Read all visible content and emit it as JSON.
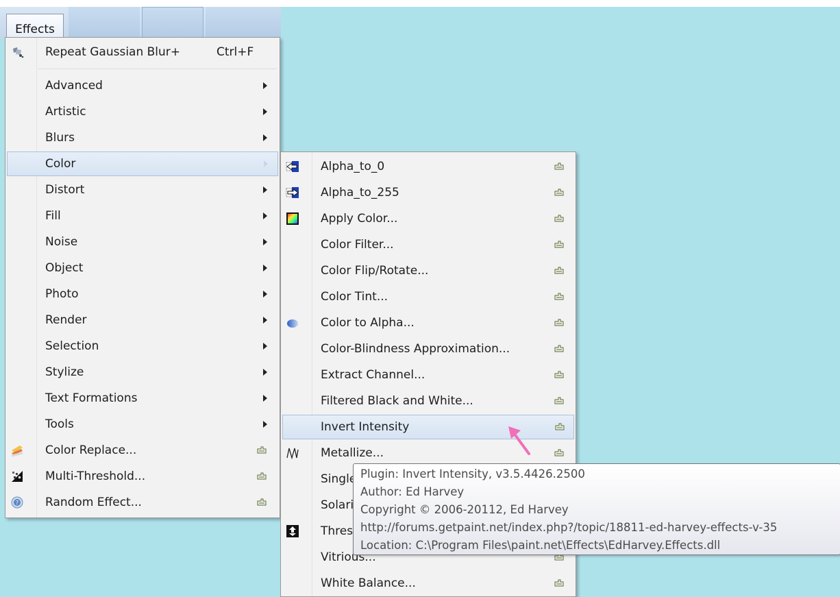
{
  "menubar": {
    "effects_label": "Effects"
  },
  "effects_menu": {
    "top_item": {
      "label": "Repeat Gaussian Blur+",
      "shortcut": "Ctrl+F",
      "icon": "gaussian-blur-icon"
    },
    "submenus": [
      {
        "label": "Advanced"
      },
      {
        "label": "Artistic"
      },
      {
        "label": "Blurs"
      },
      {
        "label": "Color"
      },
      {
        "label": "Distort"
      },
      {
        "label": "Fill"
      },
      {
        "label": "Noise"
      },
      {
        "label": "Object"
      },
      {
        "label": "Photo"
      },
      {
        "label": "Render"
      },
      {
        "label": "Selection"
      },
      {
        "label": "Stylize"
      },
      {
        "label": "Text Formations"
      },
      {
        "label": "Tools"
      }
    ],
    "effects": [
      {
        "label": "Color Replace...",
        "icon": "color-replace-icon"
      },
      {
        "label": "Multi-Threshold...",
        "icon": "multi-threshold-icon"
      },
      {
        "label": "Random Effect...",
        "icon": "random-effect-icon"
      }
    ],
    "highlighted": "Color"
  },
  "color_submenu": {
    "items": [
      {
        "label": "Alpha_to_0",
        "icon": "alpha-to-0-icon"
      },
      {
        "label": "Alpha_to_255",
        "icon": "alpha-to-255-icon"
      },
      {
        "label": "Apply Color...",
        "icon": "apply-color-icon"
      },
      {
        "label": "Color Filter...",
        "icon": ""
      },
      {
        "label": "Color Flip/Rotate...",
        "icon": ""
      },
      {
        "label": "Color Tint...",
        "icon": ""
      },
      {
        "label": "Color to Alpha...",
        "icon": "color-to-alpha-icon"
      },
      {
        "label": "Color-Blindness Approximation...",
        "icon": ""
      },
      {
        "label": "Extract Channel...",
        "icon": ""
      },
      {
        "label": "Filtered Black and White...",
        "icon": ""
      },
      {
        "label": "Invert Intensity",
        "icon": ""
      },
      {
        "label": "Metallize...",
        "icon": "metallize-icon"
      },
      {
        "label": "Single",
        "icon": ""
      },
      {
        "label": "Solari",
        "icon": ""
      },
      {
        "label": "Thres",
        "icon": "threshold-icon"
      },
      {
        "label": "Vitrious...",
        "icon": ""
      },
      {
        "label": "White Balance...",
        "icon": ""
      }
    ],
    "highlighted": "Invert Intensity"
  },
  "tooltip": {
    "lines": [
      "Plugin: Invert Intensity, v3.5.4426.2500",
      "Author: Ed Harvey",
      "Copyright ©  2006-20112, Ed Harvey",
      "http://forums.getpaint.net/index.php?/topic/18811-ed-harvey-effects-v-35",
      "Location: C:\\Program Files\\paint.net\\Effects\\EdHarvey.Effects.dll"
    ]
  },
  "colors": {
    "canvas": "#aee2eb",
    "menu_bg": "#f2f2f2",
    "highlight": "#dde8f5",
    "annotation_arrow": "#f06fb8"
  }
}
